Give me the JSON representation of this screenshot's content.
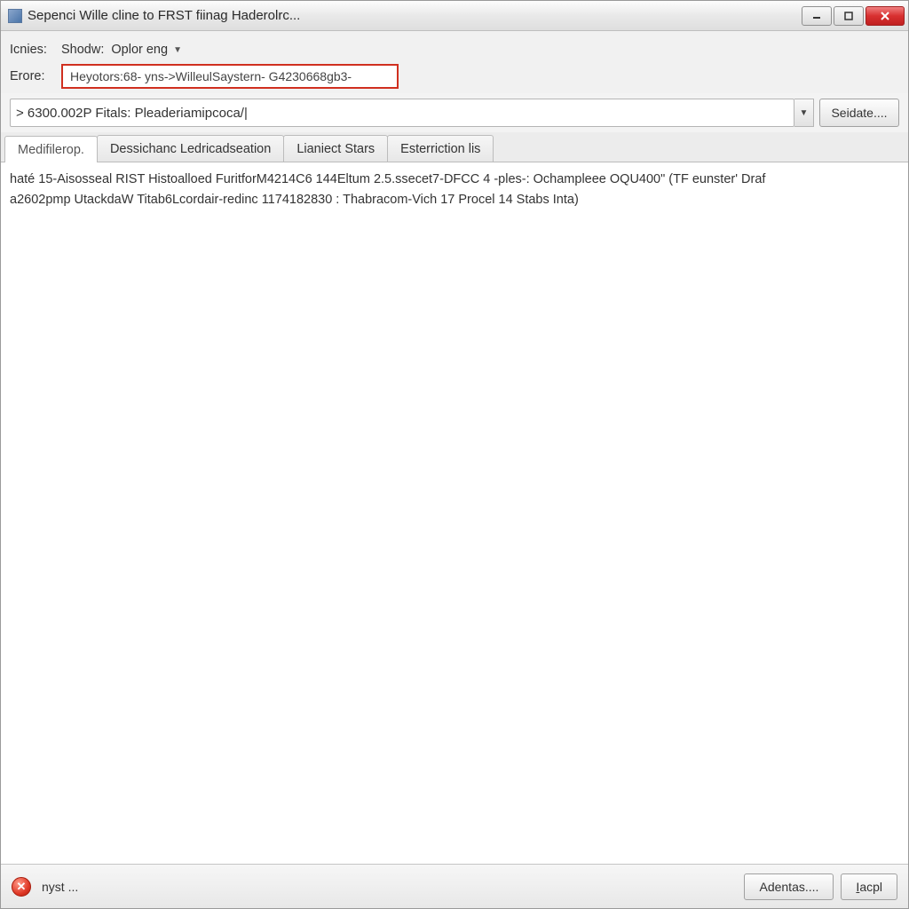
{
  "window": {
    "title": "Sepenci Wille cline to FRST fiinag Haderolrc..."
  },
  "config": {
    "icnies_label": "Icnies:",
    "show_label": "Shodw:",
    "dropdown_value": "Oplor eng",
    "erore_label": "Erore:",
    "erore_value": "Heyotors:68- yns->WilleulSaystern- G4230668gb3-"
  },
  "address": {
    "text": "> 6300.002P Fitals: Pleaderiamipcoca/|",
    "button_label": "Seidate...."
  },
  "tabs": [
    {
      "label": "Medifilerop.",
      "active": true
    },
    {
      "label": "Dessichanc Ledricadseation",
      "active": false
    },
    {
      "label": "Lianiect Stars",
      "active": false
    },
    {
      "label": "Esterriction lis",
      "active": false
    }
  ],
  "content": {
    "line1": "haté 15-Aisosseal RIST Histoalloed FuritforM4214C6 144Eltum 2.5.ssecet7-DFCC 4 -ples-: Ochampleee OQU400\" (TF eunster' Draf",
    "line2": "a2602pmp UtackdaW Titab6Lcordair-redinc 1174182830 : Thabracom-Vich 17 Procel 14 Stabs Inta)"
  },
  "footer": {
    "nyst_label": "nyst ...",
    "adentar_label": "Adentas....",
    "iacpl_prefix": "I",
    "iacpl_rest": "acpl"
  }
}
